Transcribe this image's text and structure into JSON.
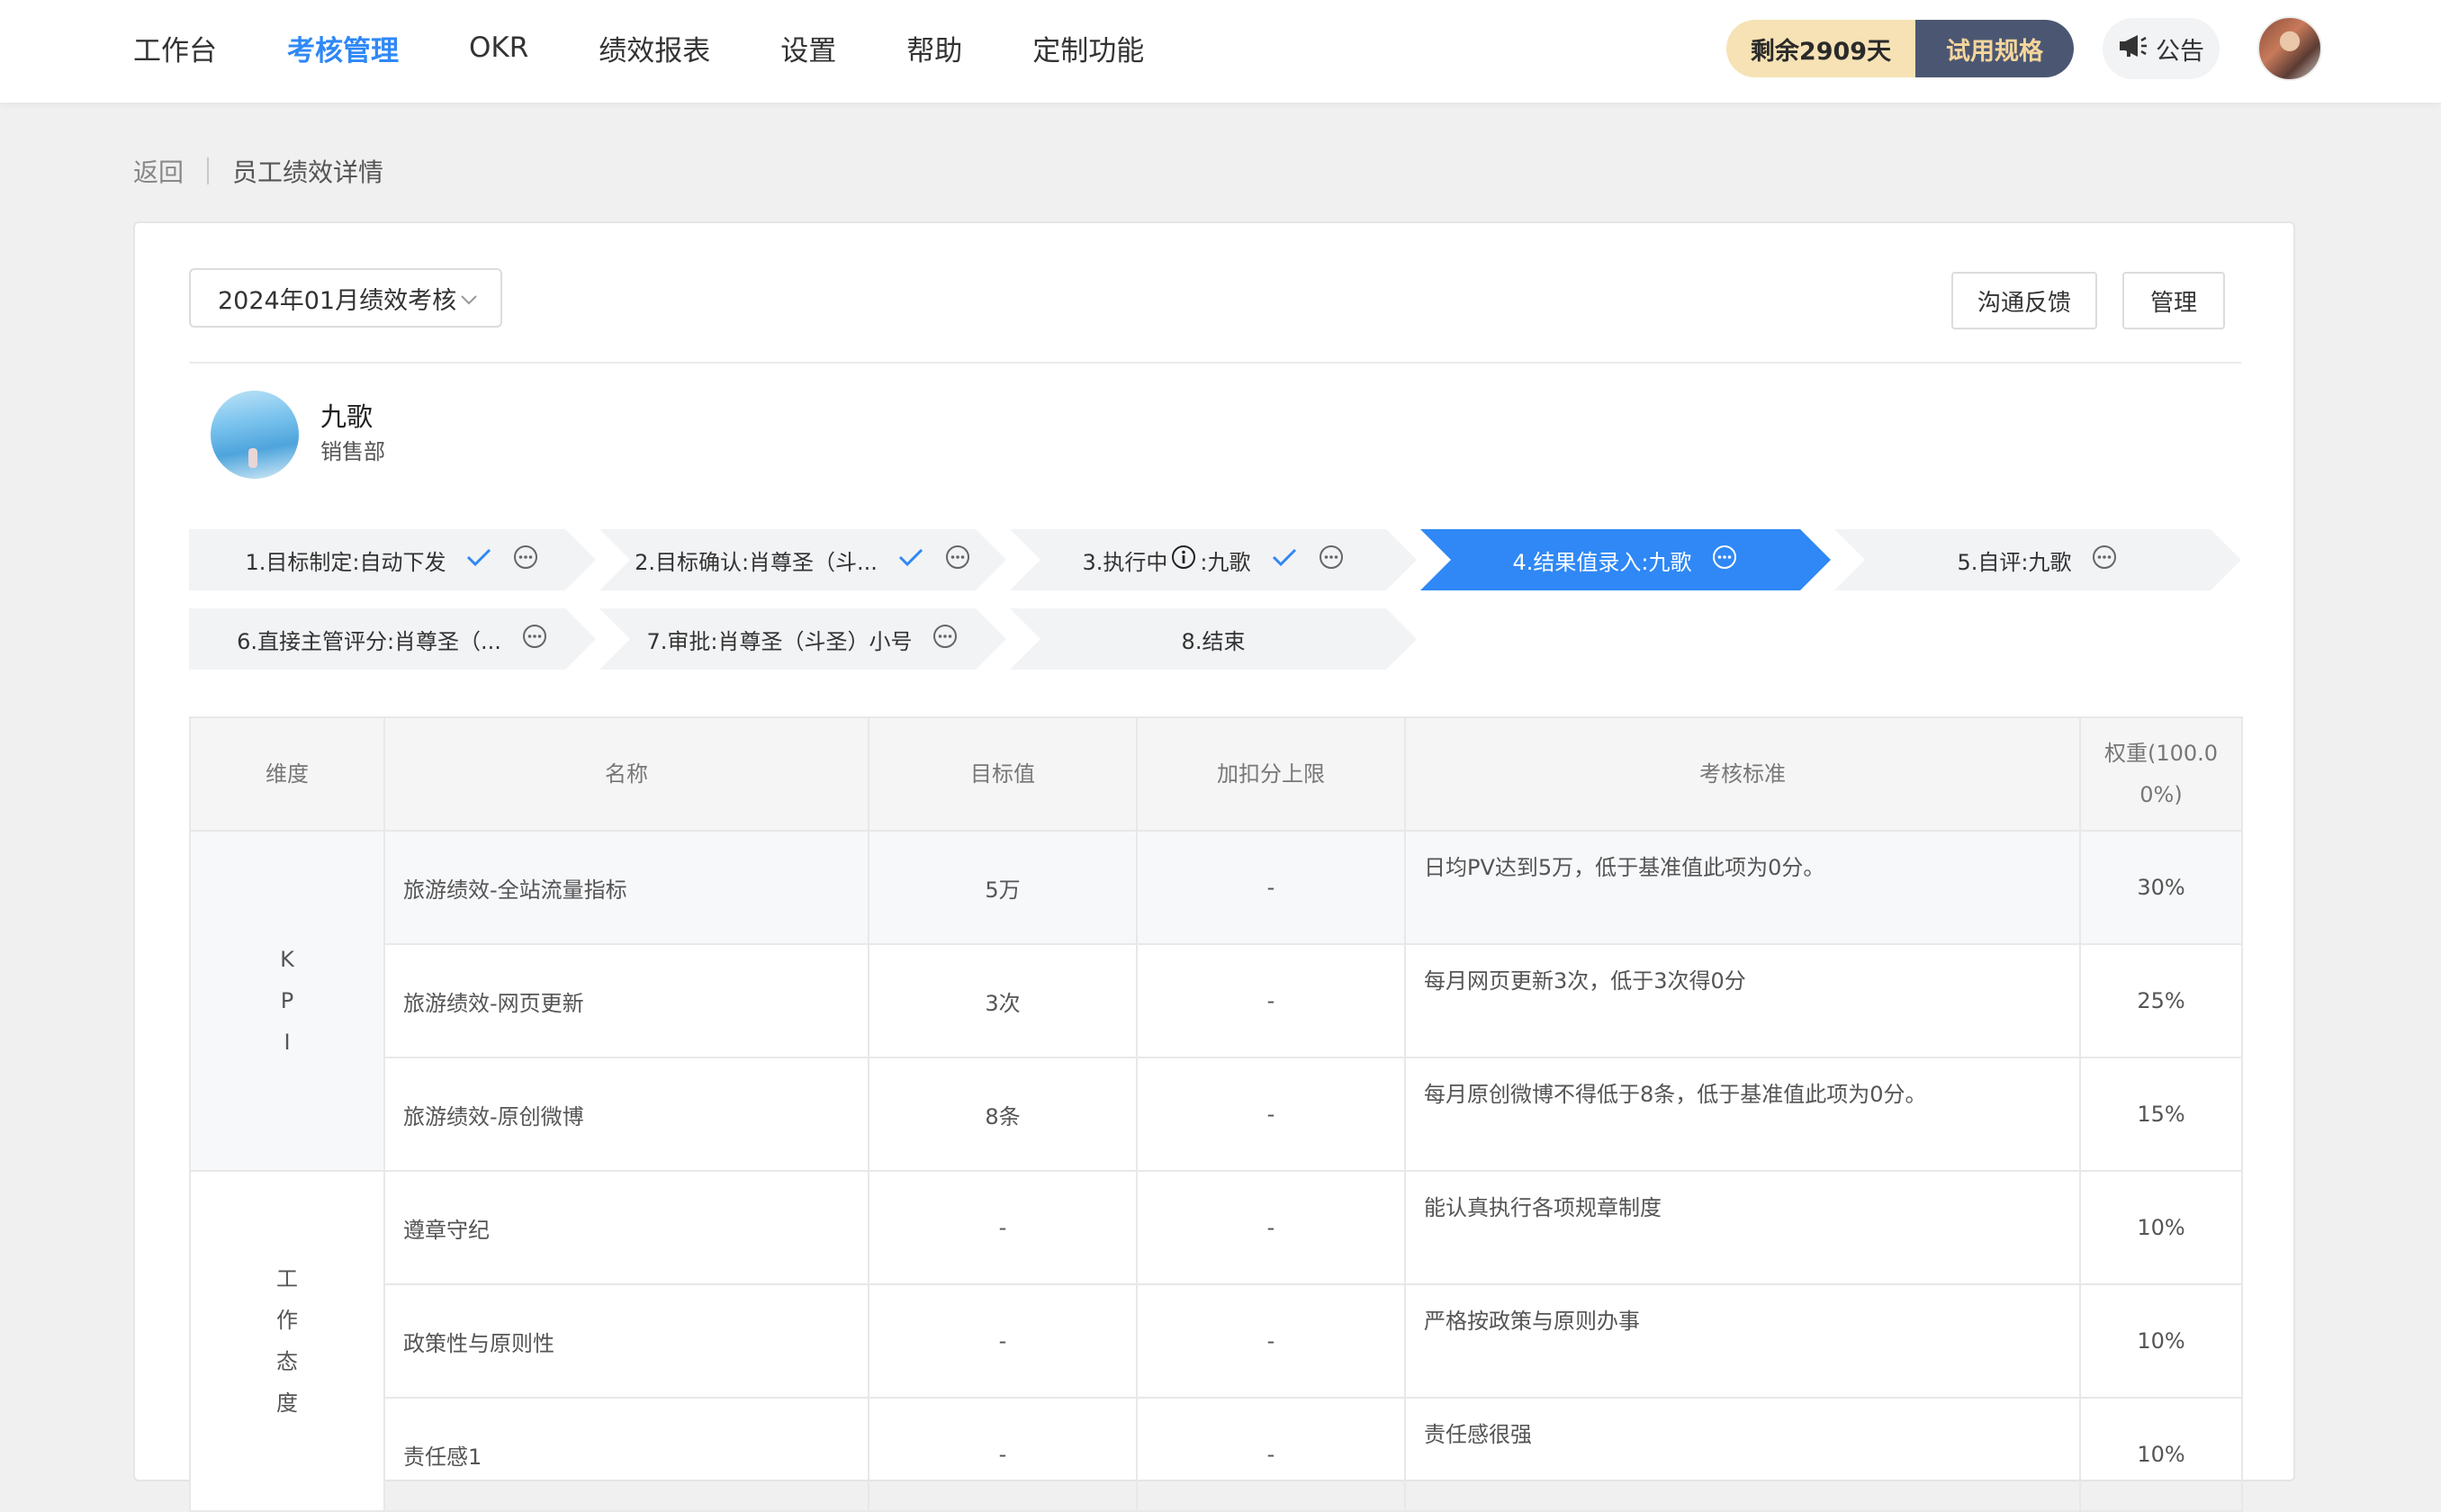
{
  "nav": {
    "items": [
      "工作台",
      "考核管理",
      "OKR",
      "绩效报表",
      "设置",
      "帮助",
      "定制功能"
    ],
    "active_index": 1
  },
  "trial": {
    "remaining": "剩余2909天",
    "spec": "试用规格"
  },
  "announcement": {
    "label": "公告"
  },
  "breadcrumb": {
    "back": "返回",
    "title": "员工绩效详情"
  },
  "period": {
    "value": "2024年01月绩效考核"
  },
  "actions": {
    "feedback": "沟通反馈",
    "manage": "管理"
  },
  "employee": {
    "name": "九歌",
    "dept": "销售部"
  },
  "steps": [
    {
      "label": "1.目标制定:自动下发",
      "done": true,
      "state": "done"
    },
    {
      "label": "2.目标确认:肖尊圣（斗...",
      "done": true,
      "state": "done"
    },
    {
      "label_pre": "3.执行中",
      "label_post": ":九歌",
      "done": true,
      "state": "done"
    },
    {
      "label": "4.结果值录入:九歌",
      "state": "active"
    },
    {
      "label": "5.自评:九歌",
      "state": "todo"
    },
    {
      "label": "6.直接主管评分:肖尊圣（...",
      "state": "todo"
    },
    {
      "label": "7.审批:肖尊圣（斗圣）小号",
      "state": "todo"
    },
    {
      "label": "8.结束",
      "state": "todo"
    }
  ],
  "table": {
    "headers": [
      "维度",
      "名称",
      "目标值",
      "加扣分上限",
      "考核标准",
      "权重(100.0\n0%)"
    ],
    "header_weight_line1": "权重(100.0",
    "header_weight_line2": "0%)",
    "groups": [
      {
        "dimension_chars": [
          "K",
          "P",
          "I"
        ],
        "rows": [
          {
            "name": "旅游绩效-全站流量指标",
            "target": "5万",
            "limit": "-",
            "standard": "日均PV达到5万，低于基准值此项为0分。",
            "weight": "30%"
          },
          {
            "name": "旅游绩效-网页更新",
            "target": "3次",
            "limit": "-",
            "standard": "每月网页更新3次，低于3次得0分",
            "weight": "25%"
          },
          {
            "name": "旅游绩效-原创微博",
            "target": "8条",
            "limit": "-",
            "standard": "每月原创微博不得低于8条，低于基准值此项为0分。",
            "weight": "15%"
          }
        ]
      },
      {
        "dimension_chars": [
          "工",
          "作",
          "态",
          "度"
        ],
        "rows": [
          {
            "name": "遵章守纪",
            "target": "-",
            "limit": "-",
            "standard": "能认真执行各项规章制度",
            "weight": "10%"
          },
          {
            "name": "政策性与原则性",
            "target": "-",
            "limit": "-",
            "standard": "严格按政策与原则办事",
            "weight": "10%"
          },
          {
            "name": "责任感1",
            "target": "-",
            "limit": "-",
            "standard": "责任感很强",
            "weight": "10%"
          }
        ]
      }
    ]
  },
  "colors": {
    "accent": "#2f88f5",
    "trial_left": "#f6e2b4",
    "trial_right": "#4b5772",
    "step_bg": "#f2f3f5"
  }
}
